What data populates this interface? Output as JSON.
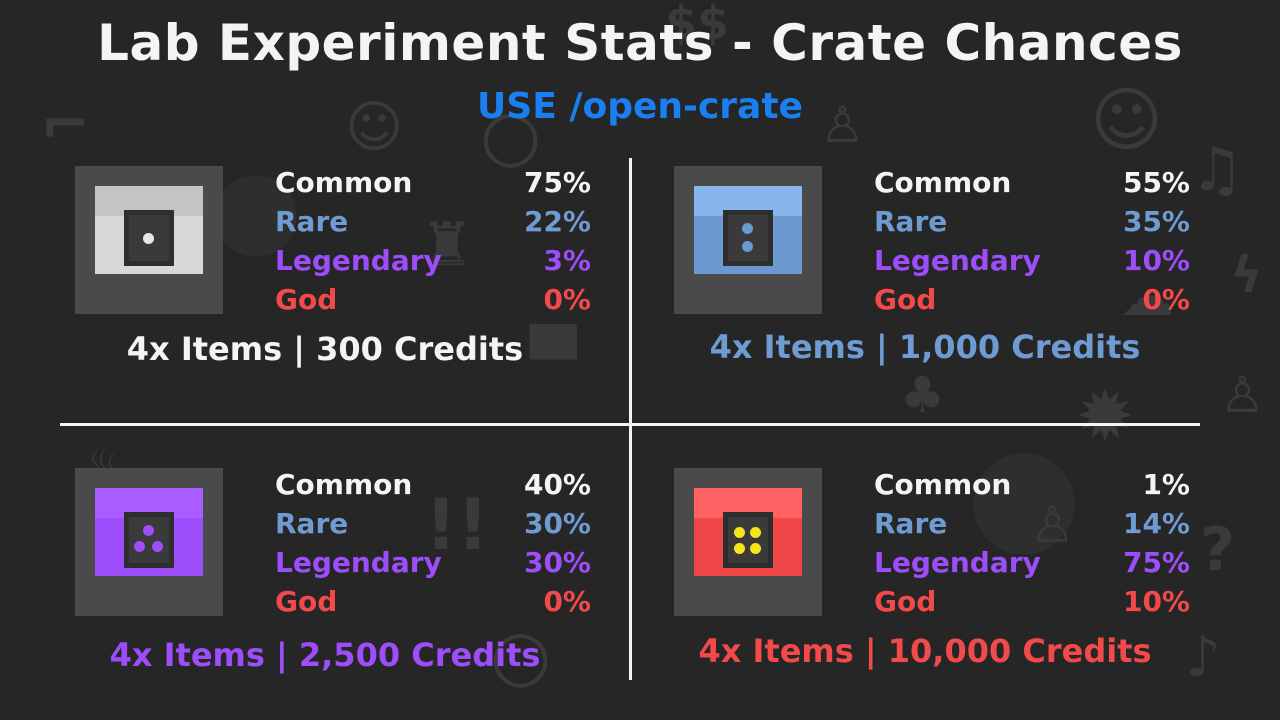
{
  "title": "Lab Experiment Stats - Crate Chances",
  "subtitle": "USE /open-crate",
  "colors": {
    "common": "#f4f4f4",
    "rare": "#6e9bd1",
    "legendary": "#9d4dfa",
    "god": "#f24a4a",
    "subtitle": "#1a7ff0"
  },
  "crates": [
    {
      "name": "common-crate",
      "color": "#d8d8d8",
      "top_color": "#c4c4c4",
      "dot_color": "#e8e8e8",
      "rows": [
        {
          "label": "Common",
          "value": "75%"
        },
        {
          "label": "Rare",
          "value": "22%"
        },
        {
          "label": "Legendary",
          "value": "3%"
        },
        {
          "label": "God",
          "value": "0%"
        }
      ],
      "footer": "4x Items | 300 Credits",
      "footer_color": "#f4f4f4"
    },
    {
      "name": "rare-crate",
      "color": "#6a98cf",
      "top_color": "#86b6ec",
      "dot_color": "#6a98cf",
      "rows": [
        {
          "label": "Common",
          "value": "55%"
        },
        {
          "label": "Rare",
          "value": "35%"
        },
        {
          "label": "Legendary",
          "value": "10%"
        },
        {
          "label": "God",
          "value": "0%"
        }
      ],
      "footer": "4x Items | 1,000 Credits",
      "footer_color": "#6e9bd1"
    },
    {
      "name": "legendary-crate",
      "color": "#9d4dfa",
      "top_color": "#a95cff",
      "dot_color": "#9d4dfa",
      "rows": [
        {
          "label": "Common",
          "value": "40%"
        },
        {
          "label": "Rare",
          "value": "30%"
        },
        {
          "label": "Legendary",
          "value": "30%"
        },
        {
          "label": "God",
          "value": "0%"
        }
      ],
      "footer": "4x Items | 2,500 Credits",
      "footer_color": "#9d4dfa"
    },
    {
      "name": "god-crate",
      "color": "#f04848",
      "top_color": "#ff6262",
      "dot_color": "#f5e51a",
      "rows": [
        {
          "label": "Common",
          "value": "1%"
        },
        {
          "label": "Rare",
          "value": "14%"
        },
        {
          "label": "Legendary",
          "value": "75%"
        },
        {
          "label": "God",
          "value": "10%"
        }
      ],
      "footer": "4x Items | 10,000 Credits",
      "footer_color": "#f24a4a"
    }
  ]
}
